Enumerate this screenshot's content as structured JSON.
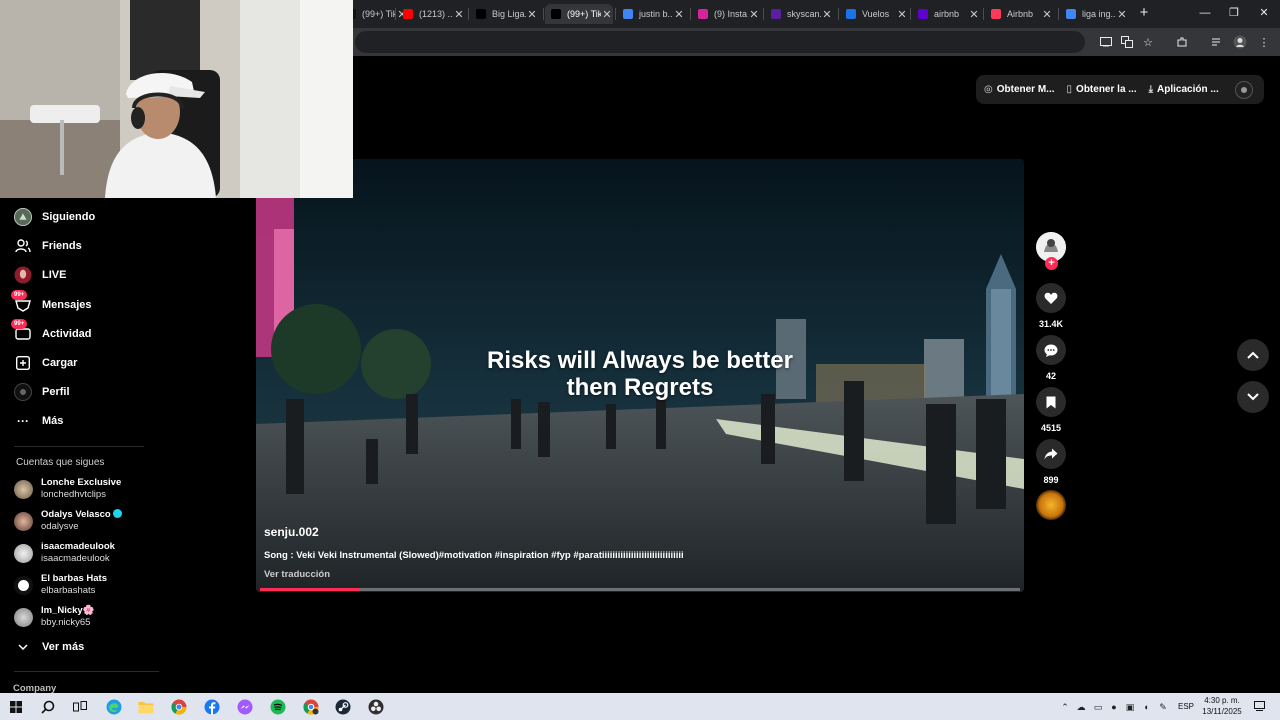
{
  "browser": {
    "tabs": [
      {
        "label": "(99+) TikTok",
        "favicon_color": "#111111"
      },
      {
        "label": "(1213) ...",
        "favicon_color": "#ff0000"
      },
      {
        "label": "Big Liga...",
        "favicon_color": "#000000"
      },
      {
        "label": "(99+) TikTok",
        "favicon_color": "#000000"
      },
      {
        "label": "justin b...",
        "favicon_color": "#4285f4"
      },
      {
        "label": "(9) Insta...",
        "favicon_color": "#d6249f"
      },
      {
        "label": "skyscan...",
        "favicon_color": "#5b1e9e"
      },
      {
        "label": "Vuelos",
        "favicon_color": "#1a73e8"
      },
      {
        "label": "airbnb",
        "favicon_color": "#6001d2"
      },
      {
        "label": "Airbnb",
        "favicon_color": "#ff385c"
      },
      {
        "label": "liga ing...",
        "favicon_color": "#4285f4"
      }
    ],
    "active_tab_index": 3,
    "close_glyph": "✕",
    "new_tab_glyph": "+",
    "window_controls": [
      "—",
      "❐",
      "✕"
    ]
  },
  "top_actions": {
    "get_coins": "Obtener M...",
    "get_app": "Obtener la ...",
    "desktop_app": "Aplicación ..."
  },
  "sidebar": {
    "items": [
      {
        "label": "Siguiendo",
        "icon": "following-avatar-icon"
      },
      {
        "label": "Friends",
        "icon": "friends-icon"
      },
      {
        "label": "LIVE",
        "icon": "live-icon"
      },
      {
        "label": "Mensajes",
        "icon": "messages-icon",
        "badge": "99+"
      },
      {
        "label": "Actividad",
        "icon": "activity-icon",
        "badge": "99+"
      },
      {
        "label": "Cargar",
        "icon": "upload-icon"
      },
      {
        "label": "Perfil",
        "icon": "profile-icon"
      },
      {
        "label": "Más",
        "icon": "more-icon"
      }
    ],
    "following_title": "Cuentas que sigues",
    "accounts": [
      {
        "name": "Lonche Exclusive",
        "handle": "lonchedhvtclips",
        "verified": false
      },
      {
        "name": "Odalys Velasco",
        "handle": "odalysve",
        "verified": true
      },
      {
        "name": "isaacmadeulook",
        "handle": "isaacmadeulook",
        "verified": false
      },
      {
        "name": "El barbas Hats",
        "handle": "elbarbashats",
        "verified": false
      },
      {
        "name": "Im_Nicky🌸",
        "handle": "bby.nicky65",
        "verified": false
      }
    ],
    "see_more": "Ver más",
    "company": "Company"
  },
  "video": {
    "caption_line1": "Risks will Always be better",
    "caption_line2": "then Regrets",
    "author": "senju.002",
    "description": "Song : Veki Veki Instrumental (Slowed)#motivation #inspiration #fyp #paratiiiiiiiiiiiiiiiiiiiiiiiiiiiiiii",
    "translate": "Ver traducción",
    "progress": 0.13
  },
  "actions": {
    "likes": "31.4K",
    "comments": "42",
    "saves": "4515",
    "shares": "899",
    "follow_plus": "+"
  },
  "taskbar": {
    "language": "ESP",
    "time": "4:30 p. m.",
    "date": "13/11/2025"
  },
  "colors": {
    "accent": "#fe2c55",
    "background": "#000000",
    "tabstrip": "#202124",
    "taskbar": "#dfe4ee"
  }
}
